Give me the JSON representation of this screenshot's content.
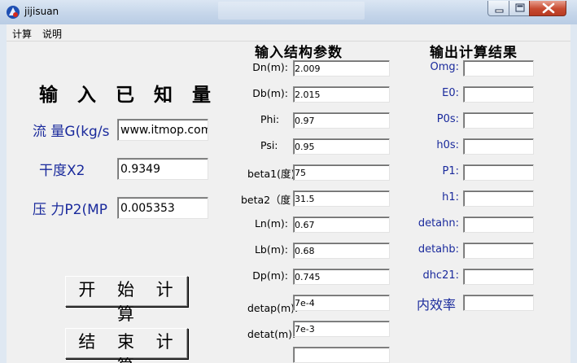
{
  "window": {
    "title": "jijisuan"
  },
  "menu": [
    "计算",
    "说明"
  ],
  "known": {
    "heading": "输 入 已 知 量",
    "flow_label": "流 量G(kg/s",
    "flow_value": "www.itmop.com",
    "dryness_label": "干度X2",
    "dryness_value": "0.9349",
    "pressure_label": "压 力P2(MP",
    "pressure_value": "0.005353"
  },
  "buttons": {
    "start": "开 始 计 算",
    "end": "结 束 计 算"
  },
  "inputs": {
    "heading": "输入结构参数",
    "fields": [
      {
        "label": "Dn(m):",
        "value": "2.009"
      },
      {
        "label": "Db(m):",
        "value": "2.015"
      },
      {
        "label": "Phi:",
        "value": "0.97"
      },
      {
        "label": "Psi:",
        "value": "0.95"
      },
      {
        "label": "beta1(度)",
        "value": "75"
      },
      {
        "label": "beta2（度",
        "value": "31.5"
      },
      {
        "label": "Ln(m):",
        "value": "0.67"
      },
      {
        "label": "Lb(m):",
        "value": "0.68"
      },
      {
        "label": "Dp(m):",
        "value": "0.745"
      },
      {
        "label": "detap(m):",
        "value": "7e-4"
      },
      {
        "label": "detat(m):",
        "value": "7e-3"
      }
    ]
  },
  "outputs": {
    "heading": "输出计算结果",
    "fields": [
      {
        "label": "Omg:",
        "value": ""
      },
      {
        "label": "E0:",
        "value": ""
      },
      {
        "label": "P0s:",
        "value": ""
      },
      {
        "label": "h0s:",
        "value": ""
      },
      {
        "label": "P1:",
        "value": ""
      },
      {
        "label": "h1:",
        "value": ""
      },
      {
        "label": "detahn:",
        "value": ""
      },
      {
        "label": "detahb:",
        "value": ""
      },
      {
        "label": "dhc21:",
        "value": ""
      },
      {
        "label": "内效率",
        "value": ""
      }
    ]
  }
}
